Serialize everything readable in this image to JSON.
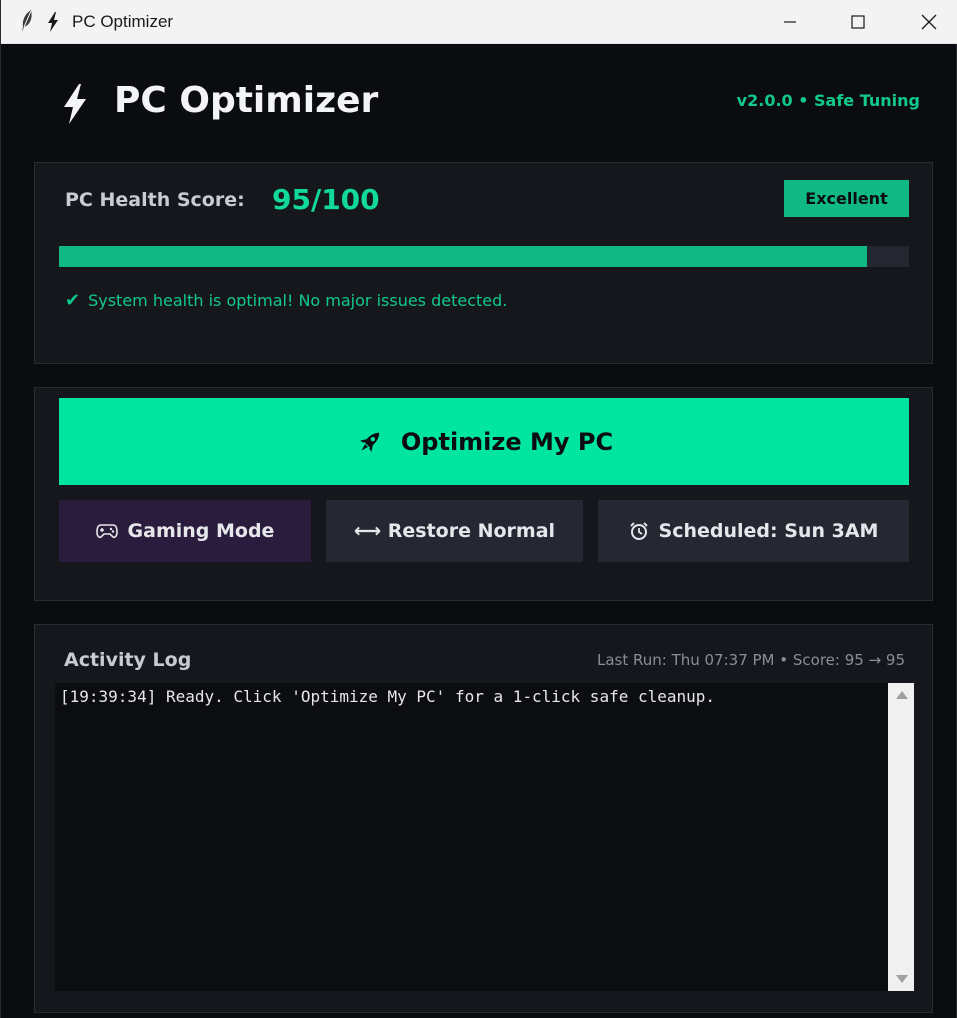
{
  "window": {
    "title": "PC Optimizer"
  },
  "header": {
    "title": "PC Optimizer",
    "version": "v2.0.0 • Safe Tuning"
  },
  "health": {
    "label": "PC Health Score:",
    "score": "95/100",
    "score_value": 95,
    "badge": "Excellent",
    "status": "System health is optimal! No major issues detected."
  },
  "actions": {
    "optimize_label": "Optimize My PC",
    "gaming_label": "Gaming Mode",
    "restore_label": "⟷ Restore Normal",
    "schedule_label": "Scheduled: Sun 3AM"
  },
  "log": {
    "title": "Activity Log",
    "last_run": "Last Run: Thu 07:37 PM • Score: 95 → 95",
    "lines": [
      "[19:39:34] Ready. Click 'Optimize My PC' for a 1-click safe cleanup."
    ]
  },
  "icons": {
    "app": "lightning-bolt-icon",
    "optimize": "rocket-icon",
    "gaming": "gamepad-icon",
    "schedule": "alarm-clock-icon",
    "status": "check-icon"
  },
  "colors": {
    "accent": "#00e5a0",
    "success": "#10b981",
    "background": "#0b0c10",
    "card": "#16171d"
  }
}
